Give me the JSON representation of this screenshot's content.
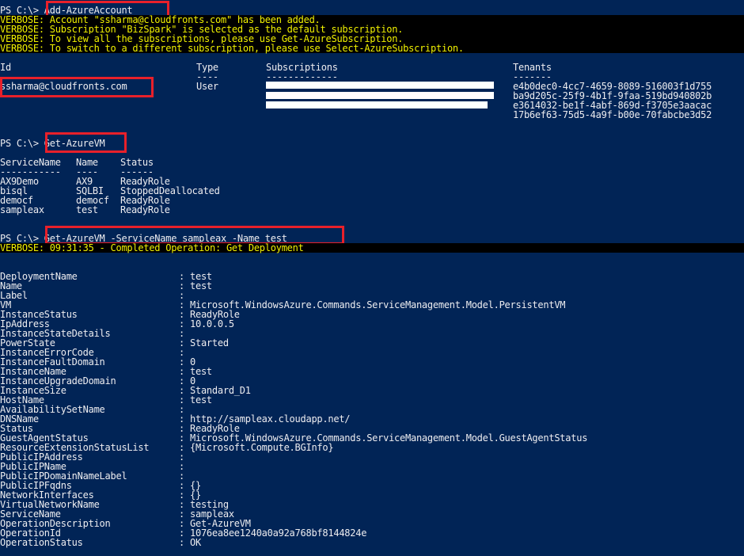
{
  "colors": {
    "background": "#012456",
    "foreground": "#eeedf0",
    "verbose_fg": "#f1f100",
    "verbose_bg": "#000000",
    "highlight": "#e8202a"
  },
  "prompt": "PS C:\\> ",
  "commands": [
    "Add-AzureAccount",
    "Get-AzureVM",
    "Get-AzureVM -ServiceName sampleax -Name test"
  ],
  "verbose_account": [
    "VERBOSE: Account \"ssharma@cloudfronts.com\" has been added.",
    "VERBOSE: Subscription \"BizSpark\" is selected as the default subscription.",
    "VERBOSE: To view all the subscriptions, please use Get-AzureSubscription.",
    "VERBOSE: To switch to a different subscription, please use Select-AzureSubscription."
  ],
  "account_table": {
    "headers": [
      "Id",
      "Type",
      "Subscriptions",
      "Tenants"
    ],
    "underlines": [
      "--",
      "----",
      "-------------",
      "-------"
    ],
    "id": "ssharma@cloudfronts.com",
    "type": "User",
    "tenants": [
      "e4b0dec0-4cc7-4659-8089-516003f1d755",
      "ba9d205c-25f9-4b1f-9faa-519bd940802b",
      "e3614032-be1f-4abf-869d-f3705e3aacac",
      "17b6ef63-75d5-4a9f-b00e-70fabcbe3d52"
    ]
  },
  "vm_list": {
    "headers": [
      "ServiceName",
      "Name",
      "Status"
    ],
    "underlines": [
      "-----------",
      "----",
      "------"
    ],
    "rows": [
      [
        "AX9Demo",
        "AX9",
        "ReadyRole"
      ],
      [
        "bisql",
        "SQLBI",
        "StoppedDeallocated"
      ],
      [
        "democf",
        "democf",
        "ReadyRole"
      ],
      [
        "sampleax",
        "test",
        "ReadyRole"
      ]
    ]
  },
  "verbose_deploy": "VERBOSE: 09:31:35 - Completed Operation: Get Deployment",
  "properties": [
    {
      "key": "DeploymentName",
      "value": "test"
    },
    {
      "key": "Name",
      "value": "test"
    },
    {
      "key": "Label",
      "value": ""
    },
    {
      "key": "VM",
      "value": "Microsoft.WindowsAzure.Commands.ServiceManagement.Model.PersistentVM"
    },
    {
      "key": "InstanceStatus",
      "value": "ReadyRole"
    },
    {
      "key": "IpAddress",
      "value": "10.0.0.5"
    },
    {
      "key": "InstanceStateDetails",
      "value": ""
    },
    {
      "key": "PowerState",
      "value": "Started"
    },
    {
      "key": "InstanceErrorCode",
      "value": ""
    },
    {
      "key": "InstanceFaultDomain",
      "value": "0"
    },
    {
      "key": "InstanceName",
      "value": "test"
    },
    {
      "key": "InstanceUpgradeDomain",
      "value": "0"
    },
    {
      "key": "InstanceSize",
      "value": "Standard_D1"
    },
    {
      "key": "HostName",
      "value": "test"
    },
    {
      "key": "AvailabilitySetName",
      "value": ""
    },
    {
      "key": "DNSName",
      "value": "http://sampleax.cloudapp.net/"
    },
    {
      "key": "Status",
      "value": "ReadyRole"
    },
    {
      "key": "GuestAgentStatus",
      "value": "Microsoft.WindowsAzure.Commands.ServiceManagement.Model.GuestAgentStatus"
    },
    {
      "key": "ResourceExtensionStatusList",
      "value": "{Microsoft.Compute.BGInfo}"
    },
    {
      "key": "PublicIPAddress",
      "value": ""
    },
    {
      "key": "PublicIPName",
      "value": ""
    },
    {
      "key": "PublicIPDomainNameLabel",
      "value": ""
    },
    {
      "key": "PublicIPFqdns",
      "value": "{}"
    },
    {
      "key": "NetworkInterfaces",
      "value": "{}"
    },
    {
      "key": "VirtualNetworkName",
      "value": "testing"
    },
    {
      "key": "ServiceName",
      "value": "sampleax"
    },
    {
      "key": "OperationDescription",
      "value": "Get-AzureVM"
    },
    {
      "key": "OperationId",
      "value": "1076ea8ee1240a0a92a768bf8144824e"
    },
    {
      "key": "OperationStatus",
      "value": "OK"
    }
  ]
}
